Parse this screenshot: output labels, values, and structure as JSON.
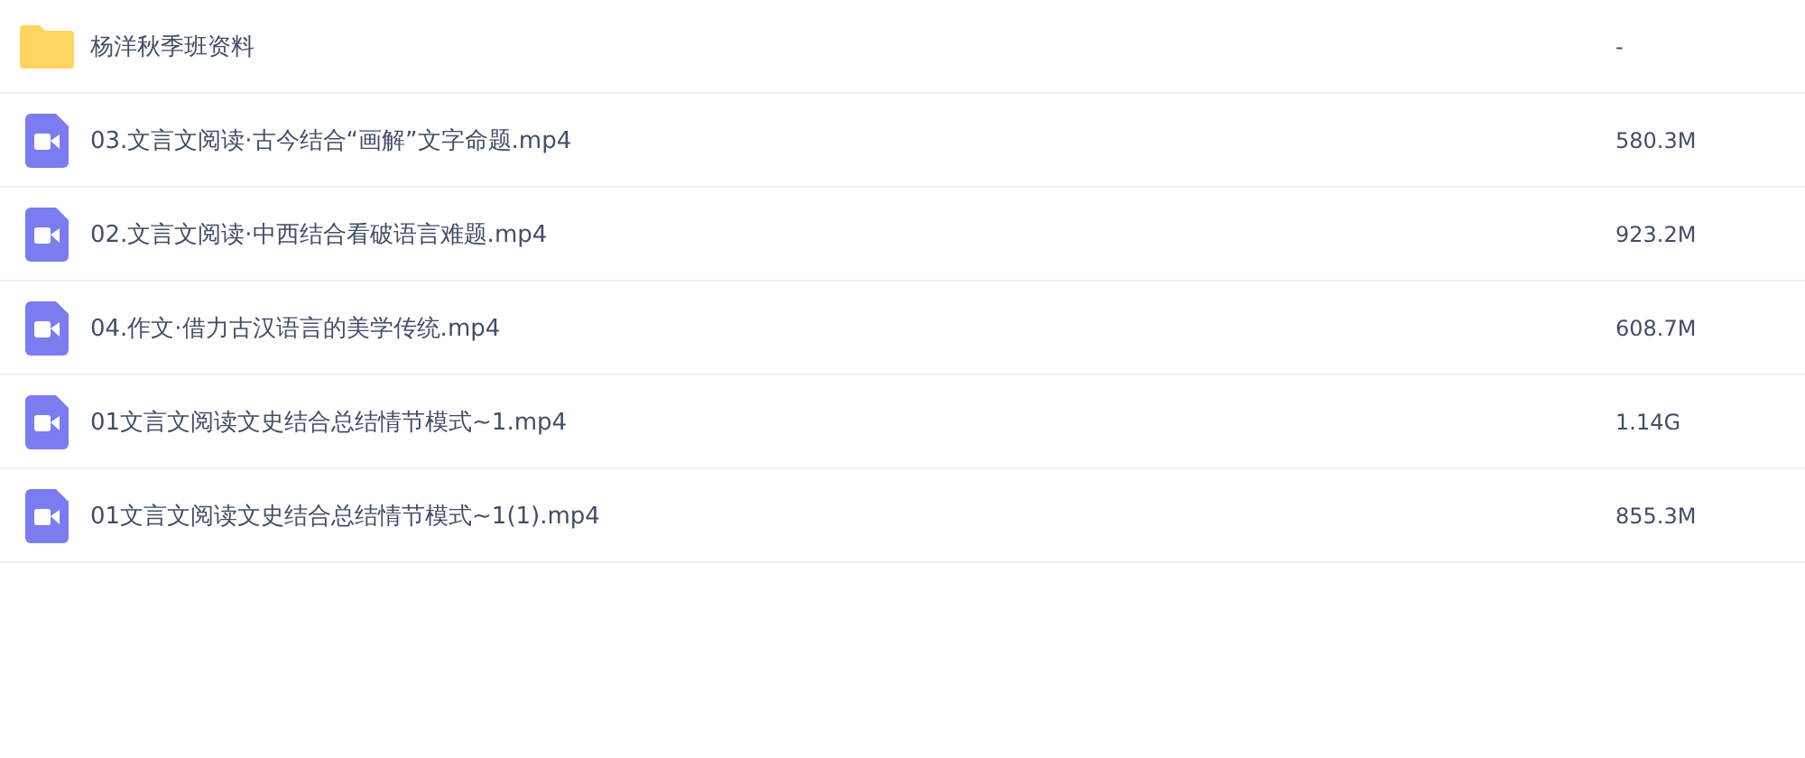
{
  "files": [
    {
      "kind": "folder",
      "name": "杨洋秋季班资料",
      "size": "-"
    },
    {
      "kind": "video",
      "name": "03.文言文阅读·古今结合“画解”文字命题.mp4",
      "size": "580.3M"
    },
    {
      "kind": "video",
      "name": "02.文言文阅读·中西结合看破语言难题.mp4",
      "size": "923.2M"
    },
    {
      "kind": "video",
      "name": "04.作文·借力古汉语言的美学传统.mp4",
      "size": "608.7M"
    },
    {
      "kind": "video",
      "name": "01文言文阅读文史结合总结情节模式~1.mp4",
      "size": "1.14G"
    },
    {
      "kind": "video",
      "name": "01文言文阅读文史结合总结情节模式~1(1).mp4",
      "size": "855.3M"
    }
  ]
}
